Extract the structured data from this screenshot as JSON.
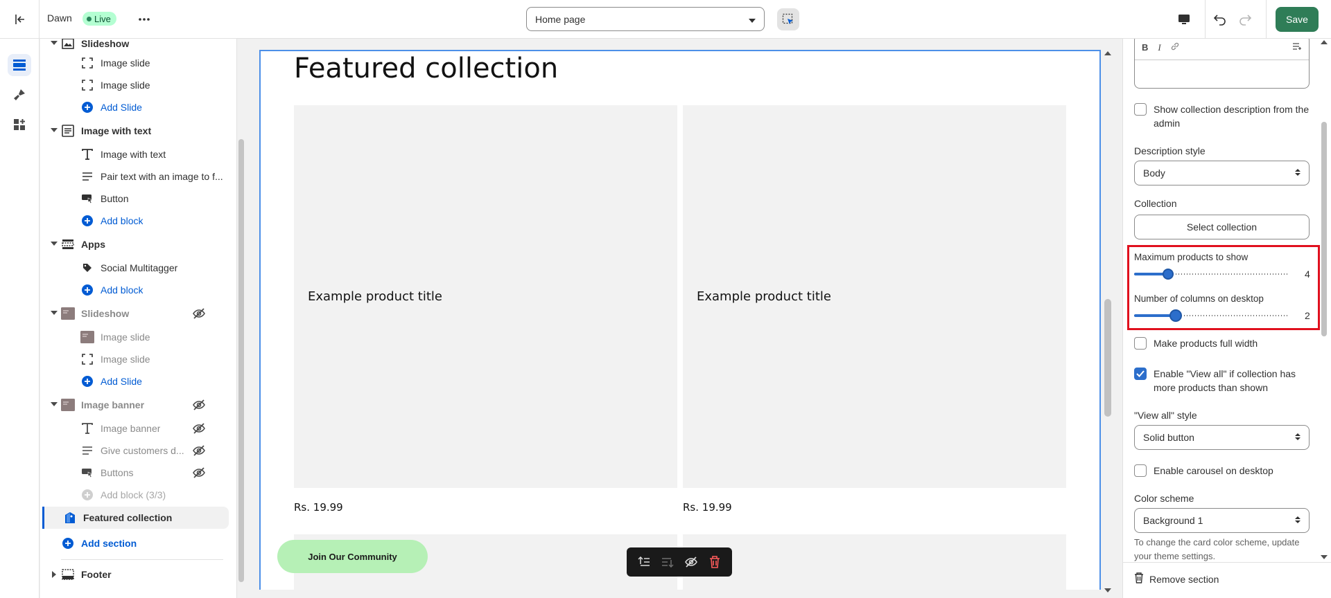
{
  "topbar": {
    "theme_name": "Dawn",
    "live_label": "Live",
    "page_select": "Home page",
    "save_label": "Save"
  },
  "sidebar": {
    "rows": [
      {
        "kind": "section",
        "label": "Slideshow"
      },
      {
        "kind": "block",
        "label": "Image slide",
        "icon": "image-slide-icon"
      },
      {
        "kind": "block",
        "label": "Image slide",
        "icon": "image-slide-icon"
      },
      {
        "kind": "add",
        "label": "Add Slide"
      },
      {
        "kind": "section",
        "label": "Image with text"
      },
      {
        "kind": "block",
        "label": "Image with text",
        "icon": "text-icon"
      },
      {
        "kind": "block",
        "label": "Pair text with an image to f...",
        "icon": "paragraph-icon"
      },
      {
        "kind": "block",
        "label": "Button",
        "icon": "button-icon"
      },
      {
        "kind": "add",
        "label": "Add block"
      },
      {
        "kind": "section",
        "label": "Apps"
      },
      {
        "kind": "block",
        "label": "Social Multitagger",
        "icon": "tag-icon"
      },
      {
        "kind": "add",
        "label": "Add block"
      },
      {
        "kind": "section",
        "label": "Slideshow",
        "hidden": true
      },
      {
        "kind": "block",
        "label": "Image slide",
        "hidden": true
      },
      {
        "kind": "block",
        "label": "Image slide",
        "hidden": true
      },
      {
        "kind": "add",
        "label": "Add Slide"
      },
      {
        "kind": "section",
        "label": "Image banner",
        "hidden": true
      },
      {
        "kind": "block",
        "label": "Image banner",
        "hidden": true
      },
      {
        "kind": "block",
        "label": "Give customers d...",
        "hidden": true
      },
      {
        "kind": "block",
        "label": "Buttons",
        "hidden": true
      },
      {
        "kind": "add-disabled",
        "label": "Add block (3/3)"
      },
      {
        "kind": "selected",
        "label": "Featured collection"
      },
      {
        "kind": "add-section",
        "label": "Add section"
      },
      {
        "kind": "footer",
        "label": "Footer"
      }
    ]
  },
  "preview": {
    "section_title": "Featured collection",
    "product_title": "Example product title",
    "price": "Rs. 19.99",
    "join_button": "Join Our Community"
  },
  "settings": {
    "show_description_label": "Show collection description from the admin",
    "description_style_label": "Description style",
    "description_style_value": "Body",
    "collection_label": "Collection",
    "select_collection_button": "Select collection",
    "max_products_label": "Maximum products to show",
    "max_products_value": "4",
    "columns_label": "Number of columns on desktop",
    "columns_value": "2",
    "full_width_label": "Make products full width",
    "view_all_label": "Enable \"View all\" if collection has more products than shown",
    "view_all_style_label": "\"View all\" style",
    "view_all_style_value": "Solid button",
    "carousel_label": "Enable carousel on desktop",
    "color_scheme_label": "Color scheme",
    "color_scheme_value": "Background 1",
    "color_scheme_help": "To change the card color scheme, update your theme settings.",
    "remove_section": "Remove section"
  },
  "colors": {
    "accent": "#005bd3",
    "save": "#2f7d57",
    "live_badge": "#b4fed2",
    "highlight": "#e0101e",
    "join_button": "#b6f0b6"
  }
}
